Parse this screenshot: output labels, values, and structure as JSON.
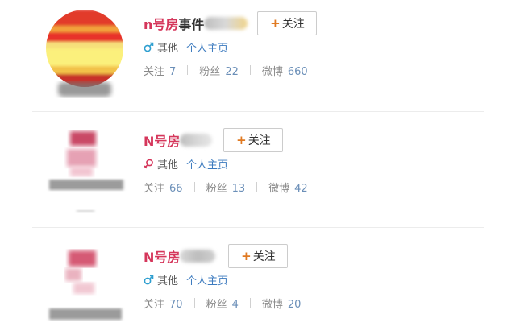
{
  "users": [
    {
      "name_prefix": "n号房",
      "name_suffix": "事件",
      "follow_label": "关注",
      "gender_icon": "male-icon",
      "gender_color": "#2f9fd0",
      "category": "其他",
      "home_link": "个人主页",
      "stats": [
        {
          "label": "关注",
          "value": "7"
        },
        {
          "label": "粉丝",
          "value": "22"
        },
        {
          "label": "微博",
          "value": "660"
        }
      ]
    },
    {
      "name_prefix": "N号房",
      "name_suffix": "",
      "follow_label": "关注",
      "gender_icon": "female-icon",
      "gender_color": "#d5365b",
      "category": "其他",
      "home_link": "个人主页",
      "stats": [
        {
          "label": "关注",
          "value": "66"
        },
        {
          "label": "粉丝",
          "value": "13"
        },
        {
          "label": "微博",
          "value": "42"
        }
      ]
    },
    {
      "name_prefix": "N号房",
      "name_suffix": "",
      "follow_label": "关注",
      "gender_icon": "male-icon",
      "gender_color": "#2f9fd0",
      "category": "其他",
      "home_link": "个人主页",
      "stats": [
        {
          "label": "关注",
          "value": "70"
        },
        {
          "label": "粉丝",
          "value": "4"
        },
        {
          "label": "微博",
          "value": "20"
        }
      ]
    }
  ]
}
